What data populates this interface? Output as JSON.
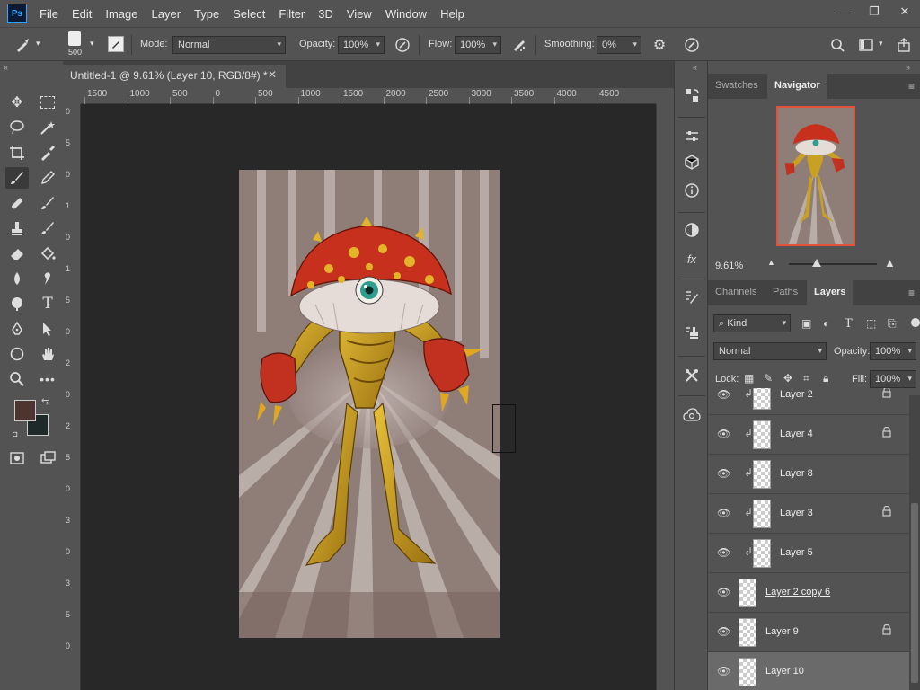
{
  "app": {
    "logo": "Ps"
  },
  "menu": [
    "File",
    "Edit",
    "Image",
    "Layer",
    "Type",
    "Select",
    "Filter",
    "3D",
    "View",
    "Window",
    "Help"
  ],
  "window_controls": {
    "minimize": "—",
    "restore": "❐",
    "close": "✕"
  },
  "options": {
    "brush_size": "500",
    "mode_label": "Mode:",
    "mode_value": "Normal",
    "opacity_label": "Opacity:",
    "opacity_value": "100%",
    "flow_label": "Flow:",
    "flow_value": "100%",
    "smoothing_label": "Smoothing:",
    "smoothing_value": "0%"
  },
  "document_tab": {
    "title": "Untitled-1 @ 9.61% (Layer 10, RGB/8#) *",
    "close": "✕"
  },
  "ruler_h": [
    "1500",
    "1000",
    "500",
    "0",
    "500",
    "1000",
    "1500",
    "2000",
    "2500",
    "3000",
    "3500",
    "4000",
    "4500"
  ],
  "ruler_v": [
    "0",
    "5",
    "0",
    "1",
    "0",
    "1",
    "5",
    "0",
    "2",
    "0",
    "2",
    "5",
    "0",
    "3",
    "0",
    "3",
    "5",
    "0"
  ],
  "colors": {
    "foreground": "#4d342e",
    "background": "#1e2a2a",
    "accent": "#e0533a"
  },
  "panel_top_tabs": [
    "Swatches",
    "Navigator"
  ],
  "navigator": {
    "zoom": "9.61%"
  },
  "panel_layer_tabs": [
    "Channels",
    "Paths",
    "Layers"
  ],
  "layers_controls": {
    "kind_label": "Kind",
    "blend_mode": "Normal",
    "opacity_label": "Opacity:",
    "opacity_value": "100%",
    "lock_label": "Lock:",
    "fill_label": "Fill:",
    "fill_value": "100%"
  },
  "layers": [
    {
      "name": "Layer 2",
      "clipped": true,
      "locked": true,
      "selected": false,
      "underline": false
    },
    {
      "name": "Layer 4",
      "clipped": true,
      "locked": true,
      "selected": false,
      "underline": false
    },
    {
      "name": "Layer 8",
      "clipped": true,
      "locked": false,
      "selected": false,
      "underline": false
    },
    {
      "name": "Layer 3",
      "clipped": true,
      "locked": true,
      "selected": false,
      "underline": false
    },
    {
      "name": "Layer 5",
      "clipped": true,
      "locked": false,
      "selected": false,
      "underline": false
    },
    {
      "name": "Layer 2 copy 6",
      "clipped": false,
      "locked": false,
      "selected": false,
      "underline": true
    },
    {
      "name": "Layer 9",
      "clipped": false,
      "locked": true,
      "selected": false,
      "underline": false
    },
    {
      "name": "Layer 10",
      "clipped": false,
      "locked": false,
      "selected": true,
      "underline": false
    }
  ]
}
